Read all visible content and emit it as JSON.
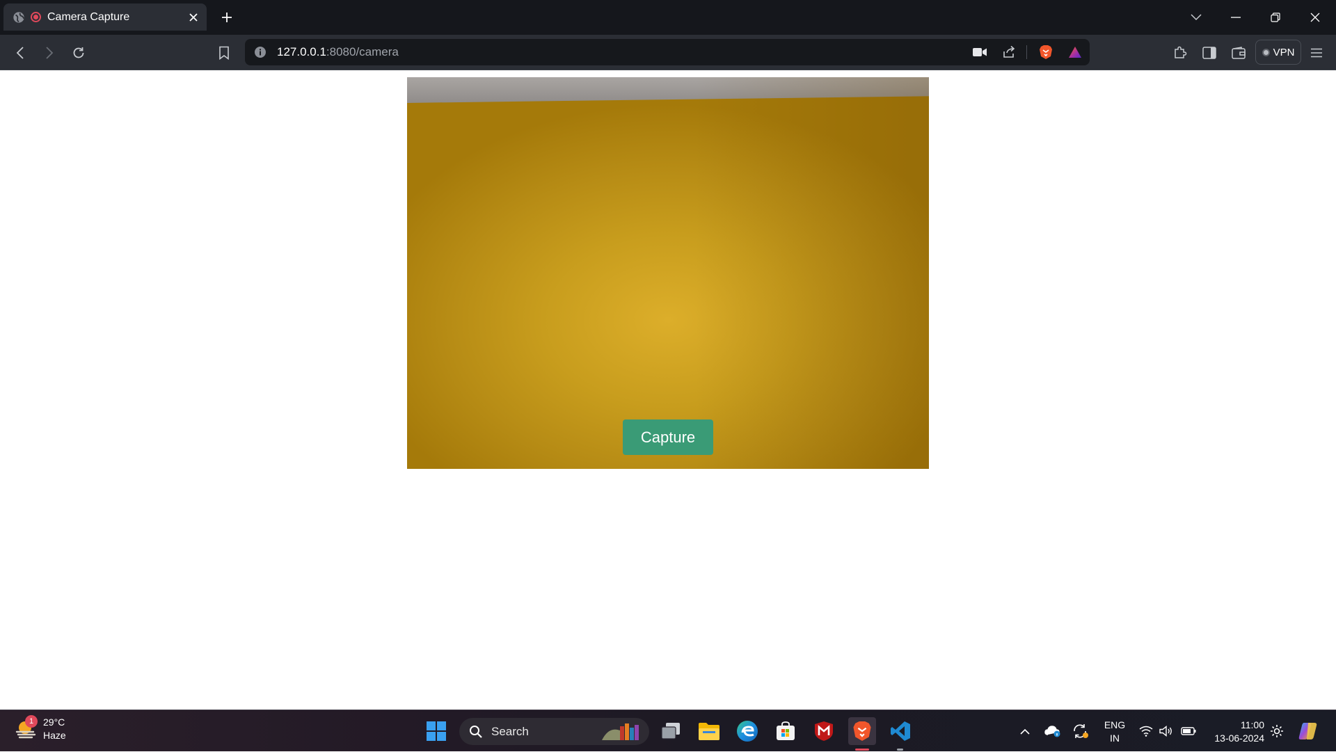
{
  "browser": {
    "tab_title": "Camera Capture",
    "url_host": "127.0.0.1",
    "url_rest": ":8080/camera",
    "vpn_label": "VPN",
    "accent": "#e0495b"
  },
  "page": {
    "capture_label": "Capture",
    "capture_color": "#3a9b76"
  },
  "taskbar": {
    "weather_temp": "29°C",
    "weather_desc": "Haze",
    "weather_badge": "1",
    "search_label": "Search",
    "lang_top": "ENG",
    "lang_bottom": "IN",
    "time": "11:00",
    "date": "13-06-2024"
  }
}
